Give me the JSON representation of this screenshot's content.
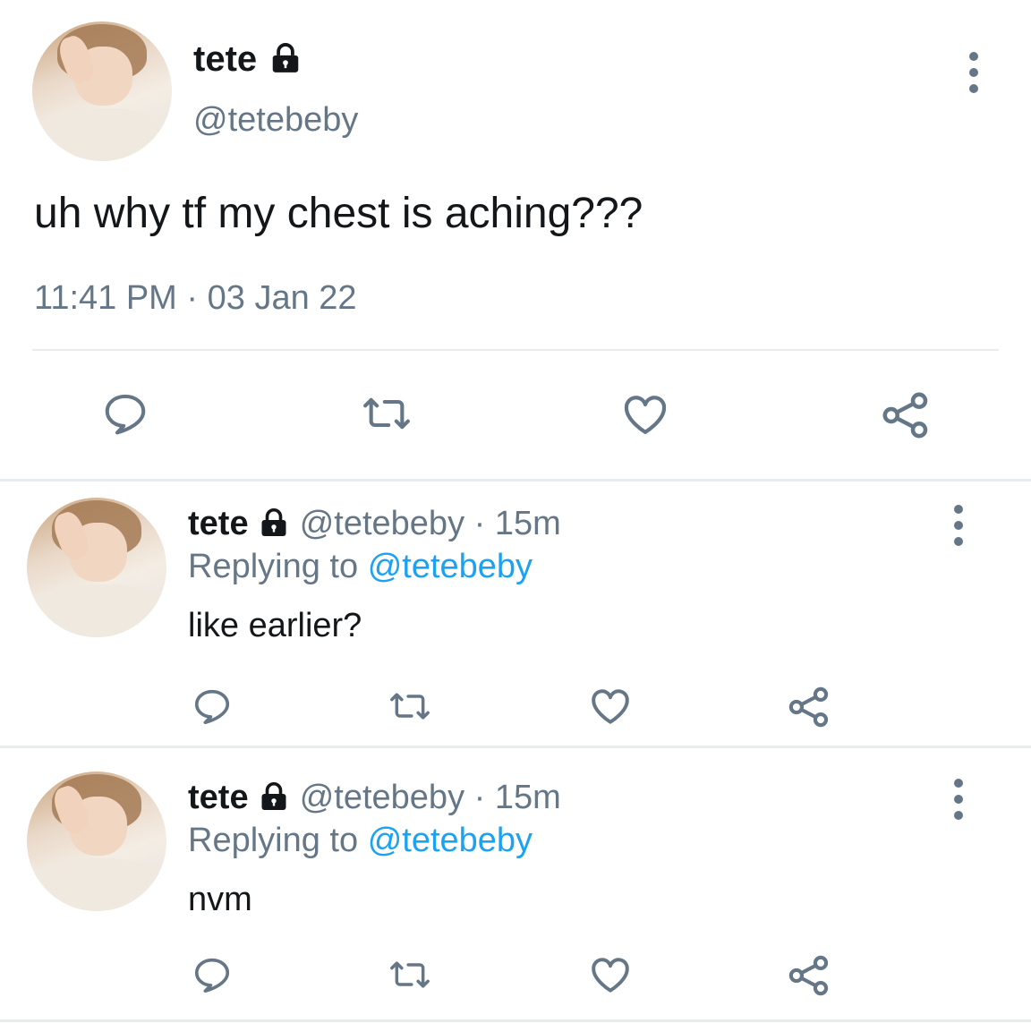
{
  "main_tweet": {
    "display_name": "tete",
    "handle": "@tetebeby",
    "text": "uh why tf my chest is aching???",
    "time": "11:41 PM",
    "separator": "·",
    "date": "03 Jan 22"
  },
  "replies": [
    {
      "display_name": "tete",
      "handle": "@tetebeby",
      "separator": "·",
      "age": "15m",
      "replying_label": "Replying to",
      "replying_handle": "@tetebeby",
      "text": "like earlier?"
    },
    {
      "display_name": "tete",
      "handle": "@tetebeby",
      "separator": "·",
      "age": "15m",
      "replying_label": "Replying to",
      "replying_handle": "@tetebeby",
      "text": "nvm"
    }
  ],
  "icons": {
    "lock": "lock-icon",
    "more": "more-vertical-icon",
    "reply": "reply-icon",
    "retweet": "retweet-icon",
    "like": "heart-icon",
    "share": "share-icon"
  },
  "colors": {
    "text": "#14171a",
    "muted": "#657786",
    "link": "#1da1f2",
    "divider": "#e6ecf0"
  }
}
